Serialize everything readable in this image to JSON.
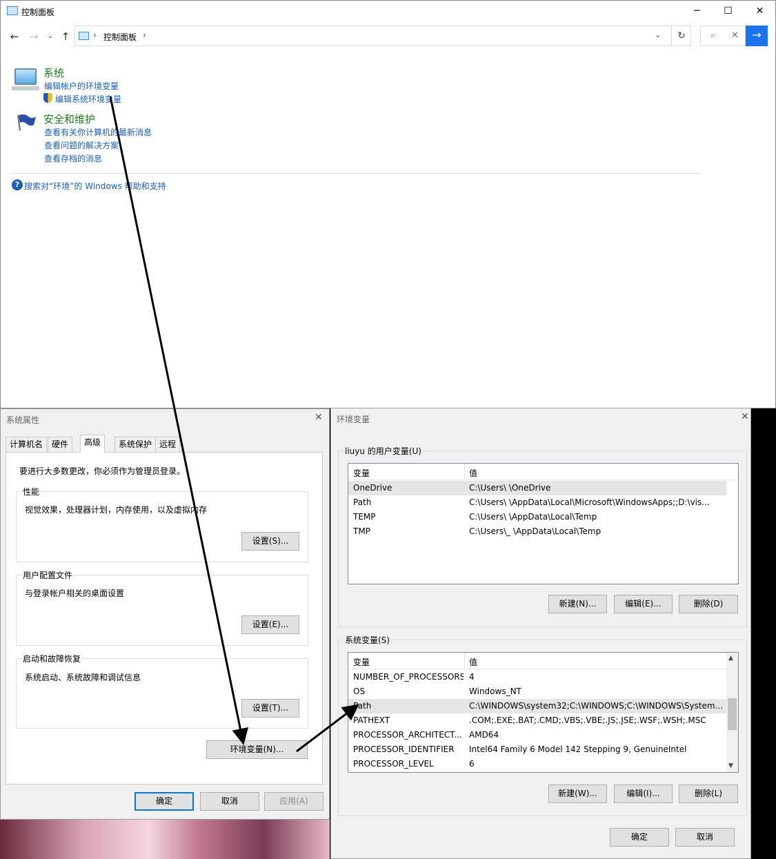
{
  "control_panel": {
    "title": "控制面板",
    "breadcrumb": "控制面板",
    "window_controls": [
      "─",
      "☐",
      "✕"
    ],
    "categories": [
      {
        "title": "系统",
        "links": [
          "编辑帐户的环境变量",
          "编辑系统环境变量"
        ]
      },
      {
        "title": "安全和维护",
        "links": [
          "查看有关你计算机的最新消息",
          "查看问题的解决方案",
          "查看存档的消息"
        ]
      }
    ],
    "help_link": "搜索对“环境”的 Windows 帮助和支持"
  },
  "system_properties": {
    "title": "系统属性",
    "tabs": [
      "计算机名",
      "硬件",
      "高级",
      "系统保护",
      "远程"
    ],
    "active_tab": "高级",
    "admin_note": "要进行大多数更改，你必须作为管理员登录。",
    "groups": [
      {
        "label": "性能",
        "desc": "视觉效果，处理器计划，内存使用，以及虚拟内存",
        "button": "设置(S)..."
      },
      {
        "label": "用户配置文件",
        "desc": "与登录帐户相关的桌面设置",
        "button": "设置(E)..."
      },
      {
        "label": "启动和故障恢复",
        "desc": "系统启动、系统故障和调试信息",
        "button": "设置(T)..."
      }
    ],
    "env_button": "环境变量(N)...",
    "ok": "确定",
    "cancel": "取消",
    "apply": "应用(A)"
  },
  "env_vars": {
    "title": "环境变量",
    "user_section": "liuyu 的用户变量(U)",
    "system_section": "系统变量(S)",
    "col_var": "变量",
    "col_val": "值",
    "user_rows": [
      {
        "name": "OneDrive",
        "value": "C:\\Users\\      \\OneDrive"
      },
      {
        "name": "Path",
        "value": "C:\\Users\\      \\AppData\\Local\\Microsoft\\WindowsApps;;D:\\vis..."
      },
      {
        "name": "TEMP",
        "value": "C:\\Users\\      \\AppData\\Local\\Temp"
      },
      {
        "name": "TMP",
        "value": "C:\\Users\\_     \\AppData\\Local\\Temp"
      }
    ],
    "user_buttons": [
      "新建(N)...",
      "编辑(E)...",
      "删除(D)"
    ],
    "system_rows": [
      {
        "name": "NUMBER_OF_PROCESSORS",
        "value": "4"
      },
      {
        "name": "OS",
        "value": "Windows_NT"
      },
      {
        "name": "Path",
        "value": "C:\\WINDOWS\\system32;C:\\WINDOWS;C:\\WINDOWS\\System..."
      },
      {
        "name": "PATHEXT",
        "value": ".COM;.EXE;.BAT;.CMD;.VBS;.VBE;.JS;.JSE;.WSF;.WSH;.MSC"
      },
      {
        "name": "PROCESSOR_ARCHITECT...",
        "value": "AMD64"
      },
      {
        "name": "PROCESSOR_IDENTIFIER",
        "value": "Intel64 Family 6 Model 142 Stepping 9, GenuineIntel"
      },
      {
        "name": "PROCESSOR_LEVEL",
        "value": "6"
      }
    ],
    "system_buttons": [
      "新建(W)...",
      "编辑(I)...",
      "删除(L)"
    ],
    "ok": "确定",
    "cancel": "取消"
  }
}
